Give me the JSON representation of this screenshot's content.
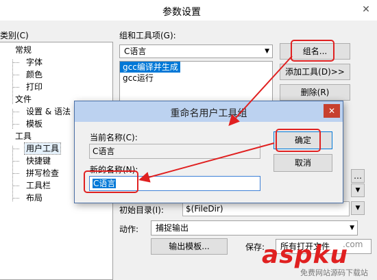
{
  "window": {
    "title": "参数设置",
    "close_glyph": "✕"
  },
  "category_label": "类别(C)",
  "tree": {
    "items": [
      {
        "label": "常规"
      },
      {
        "label": "字体"
      },
      {
        "label": "颜色"
      },
      {
        "label": "打印"
      },
      {
        "label": "文件"
      },
      {
        "label": "设置 & 语法"
      },
      {
        "label": "模板"
      },
      {
        "label": "工具"
      },
      {
        "label": "用户工具"
      },
      {
        "label": "快捷键"
      },
      {
        "label": "拼写检查"
      },
      {
        "label": "工具栏"
      },
      {
        "label": "布局"
      }
    ]
  },
  "group": {
    "label": "组和工具项(G):",
    "combo_value": "C语言",
    "list": [
      "gcc编译并生成",
      "gcc运行"
    ]
  },
  "buttons": {
    "group_name": "组名...",
    "add_tool": "添加工具(D)>>",
    "delete": "删除(R)",
    "output_template": "输出模板..."
  },
  "initial_dir": {
    "label": "初始目录(I):",
    "value": "$(FileDir)"
  },
  "action": {
    "label": "动作:",
    "value": "捕捉输出"
  },
  "save": {
    "label": "保存:",
    "value": "所有打开文件"
  },
  "dialog": {
    "title": "重命名用户工具组",
    "close_glyph": "✕",
    "current_label": "当前名称(C):",
    "current_value": "C语言",
    "new_label": "新的名称(N):",
    "new_value": "C语言",
    "ok": "确定",
    "cancel": "取消"
  },
  "watermark": {
    "brand": "aspku",
    "dot_com": ".com",
    "tagline": "免费网站源码下载站"
  },
  "accent": "#e02020"
}
